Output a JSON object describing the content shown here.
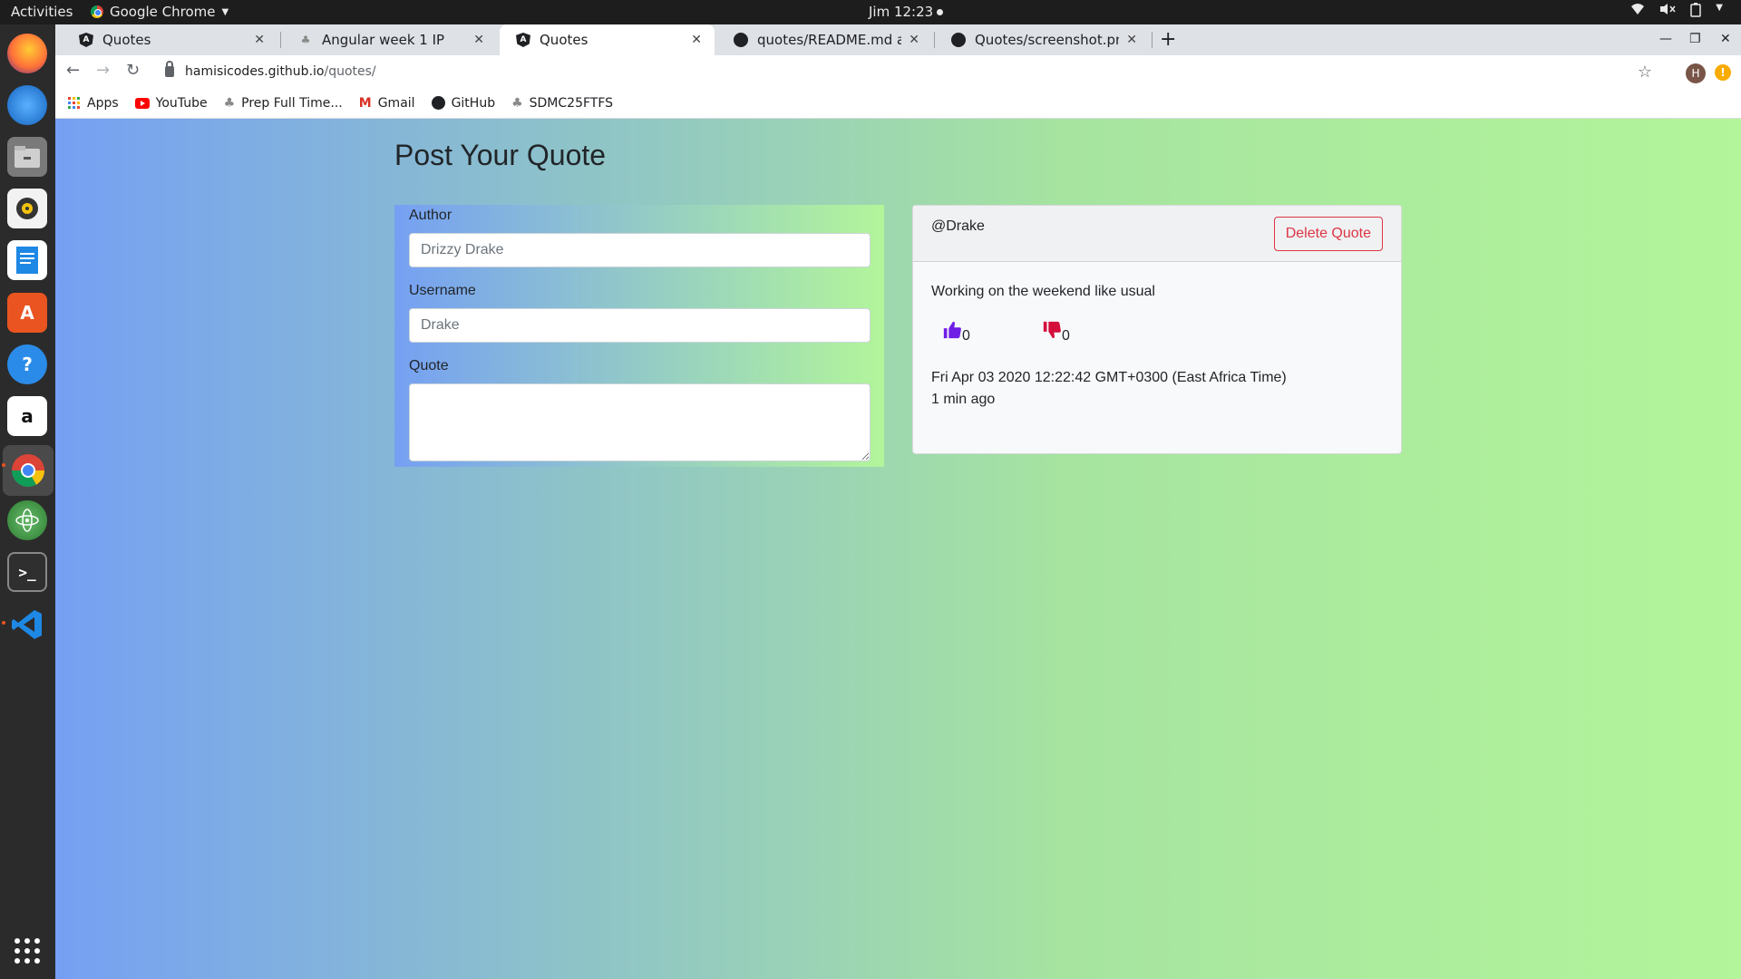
{
  "topbar": {
    "activities": "Activities",
    "app_name": "Google Chrome",
    "clock": "Jim 12:23"
  },
  "dock": {
    "items": [
      "firefox-icon",
      "thunderbird-icon",
      "files-icon",
      "rhythmbox-icon",
      "writer-icon",
      "software-icon",
      "help-icon",
      "amazon-icon",
      "chrome-icon",
      "atom-icon",
      "terminal-icon",
      "vscode-icon"
    ]
  },
  "tabs": [
    {
      "title": "Quotes",
      "icon": "angular-icon",
      "active": false
    },
    {
      "title": "Angular week 1 IP",
      "icon": "palm-icon",
      "active": false
    },
    {
      "title": "Quotes",
      "icon": "angular-icon",
      "active": true
    },
    {
      "title": "quotes/README.md at m",
      "icon": "github-icon",
      "active": false
    },
    {
      "title": "Quotes/screenshot.png a",
      "icon": "github-icon",
      "active": false
    }
  ],
  "address": {
    "host": "hamisicodes.github.io",
    "path": "/quotes/",
    "avatar_letter": "H"
  },
  "bookmarks": [
    "Apps",
    "YouTube",
    "Prep Full Time...",
    "Gmail",
    "GitHub",
    "SDMC25FTFS"
  ],
  "page": {
    "title": "Post Your Quote",
    "form": {
      "author_label": "Author",
      "author_placeholder": "Drizzy Drake",
      "username_label": "Username",
      "username_placeholder": "Drake",
      "quote_label": "Quote"
    },
    "card": {
      "username": "@Drake",
      "delete_label": "Delete Quote",
      "quote": "Working on the weekend like usual",
      "upvotes": "0",
      "downvotes": "0",
      "date": "Fri Apr 03 2020 12:22:42 GMT+0300 (East Africa Time)",
      "ago": "1 min ago"
    }
  },
  "colors": {
    "upvote": "#6f1ee6",
    "downvote": "#d40f3c",
    "danger": "#dc3545"
  }
}
